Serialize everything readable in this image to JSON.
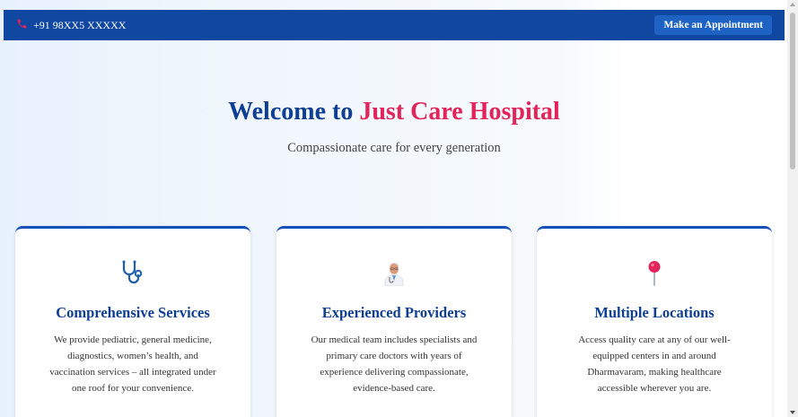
{
  "topbar": {
    "phone": "+91 98XX5 XXXXX",
    "appointment_button": "Make an Appointment"
  },
  "hero": {
    "title_prefix": "Welcome to ",
    "title_brand": "Just Care Hospital",
    "subtitle": "Compassionate care for every generation"
  },
  "cards": [
    {
      "icon": "stethoscope-icon",
      "title": "Comprehensive Services",
      "description": "We provide pediatric, general medicine, diagnostics, women’s health, and vaccination services – all integrated under one roof for your convenience."
    },
    {
      "icon": "doctor-icon",
      "title": "Experienced Providers",
      "description": "Our medical team includes specialists and primary care doctors with years of experience delivering compassionate, evidence-based care."
    },
    {
      "icon": "map-pin-icon",
      "title": "Multiple Locations",
      "description": "Access quality care at any of our well-equipped centers in and around Dharmavaram, making healthcare accessible wherever you are."
    }
  ],
  "colors": {
    "primary": "#0f47a1",
    "accent": "#e3245a",
    "heading": "#0f3f95"
  }
}
